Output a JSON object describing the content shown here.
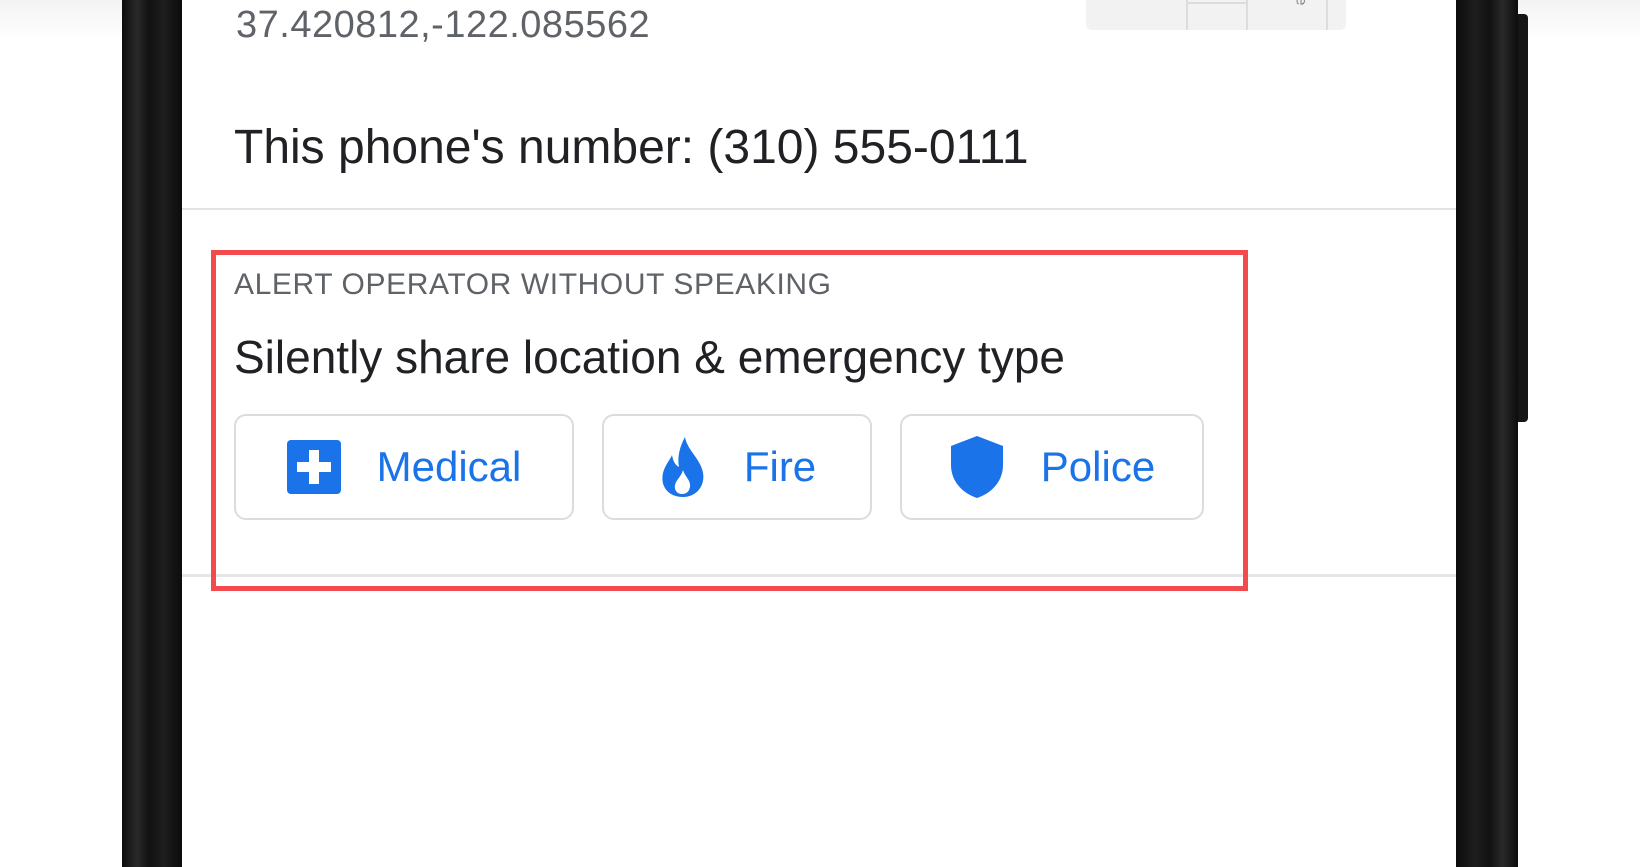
{
  "location": {
    "coordinates": "37.420812,-122.085562"
  },
  "phone": {
    "number_text": "This phone's number: (310) 555-0111"
  },
  "silent_alert": {
    "label": "ALERT OPERATOR WITHOUT SPEAKING",
    "title": "Silently share location & emergency type",
    "buttons": [
      {
        "label": "Medical",
        "icon": "medical-cross-icon"
      },
      {
        "label": "Fire",
        "icon": "fire-icon"
      },
      {
        "label": "Police",
        "icon": "shield-icon"
      }
    ]
  },
  "map_preview": {
    "letter": "e"
  },
  "colors": {
    "accent_blue": "#1a73e8",
    "highlight_red": "#f24a4d",
    "primary_text": "#202124",
    "secondary_text": "#5f6368"
  }
}
